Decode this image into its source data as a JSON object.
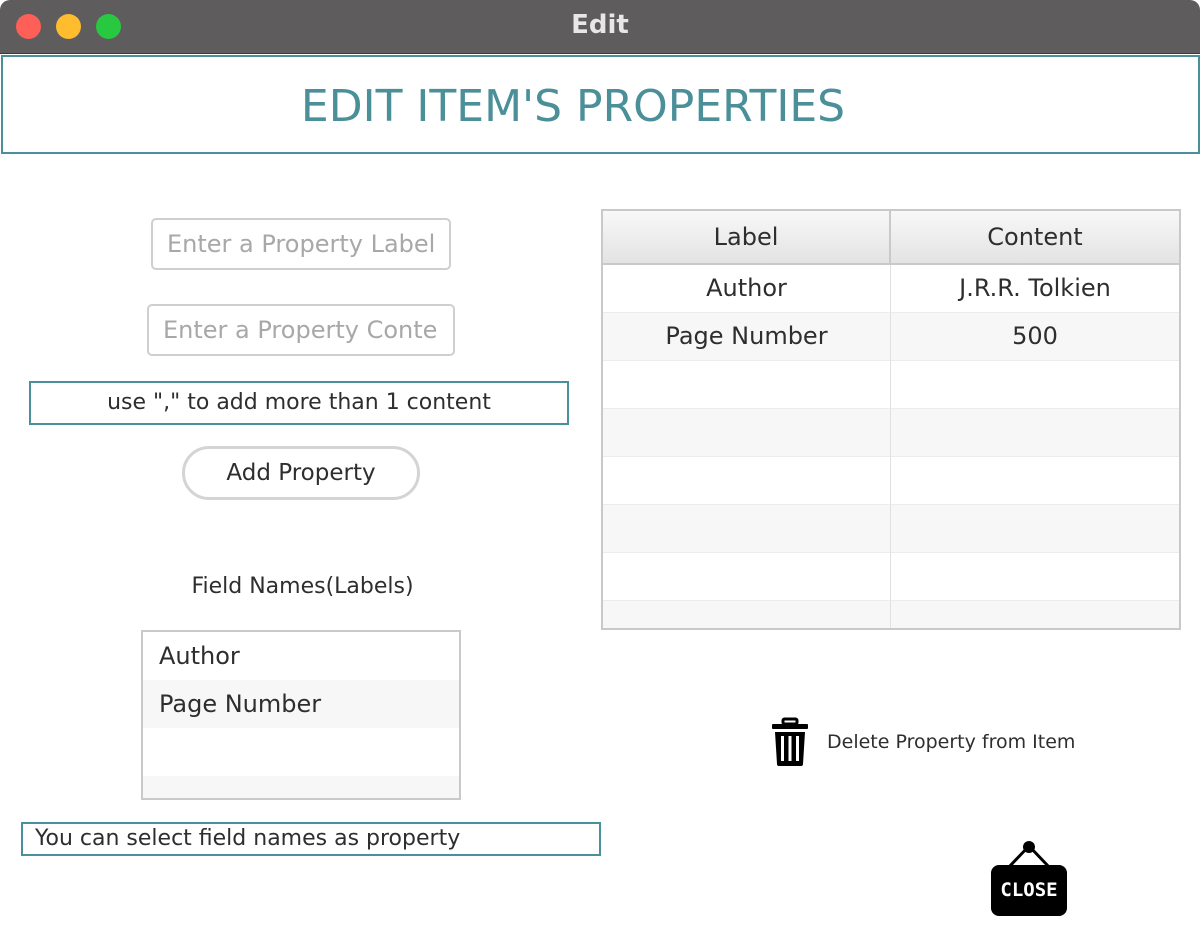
{
  "window": {
    "title": "Edit"
  },
  "header": {
    "heading": "EDIT ITEM'S PROPERTIES"
  },
  "form": {
    "label_placeholder": "Enter a Property Label",
    "content_placeholder": "Enter a Property Content",
    "comma_hint": "use  \",\" to add more than  1 content",
    "add_button": "Add Property",
    "field_names_title": "Field Names(Labels)",
    "select_hint": "You can select  field names as property"
  },
  "field_names": [
    "Author",
    "Page Number"
  ],
  "table": {
    "columns": [
      "Label",
      "Content"
    ],
    "rows": [
      {
        "label": "Author",
        "content": "J.R.R. Tolkien"
      },
      {
        "label": "Page Number",
        "content": "500"
      }
    ]
  },
  "actions": {
    "delete_label": "Delete Property from Item",
    "delete_icon": "trash-icon",
    "close_label": "CLOSE",
    "close_icon": "hanging-sign-icon"
  },
  "colors": {
    "accent": "#4b8f99",
    "titlebar": "#5f5c5e"
  }
}
